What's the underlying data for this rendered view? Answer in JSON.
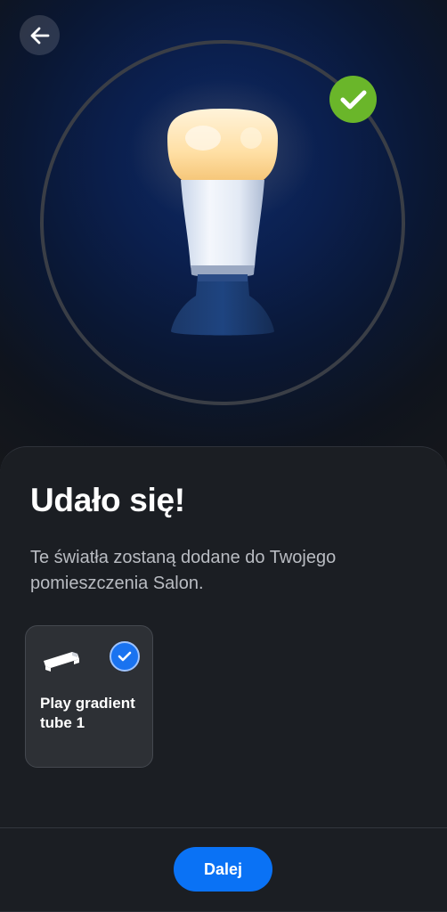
{
  "header": {
    "back_icon": "arrow-left-icon",
    "success_icon": "checkmark-icon"
  },
  "content": {
    "title": "Udało się!",
    "description": "Te światła zostaną dodane do Twojego pomieszczenia Salon."
  },
  "lights": [
    {
      "name": "Play gradient tube 1",
      "icon": "gradient-tube-icon",
      "selected": true
    }
  ],
  "footer": {
    "next_label": "Dalej"
  },
  "colors": {
    "accent": "#0a72f5",
    "success": "#6ab62a",
    "background": "#1b1e23",
    "card": "#2d3035"
  }
}
